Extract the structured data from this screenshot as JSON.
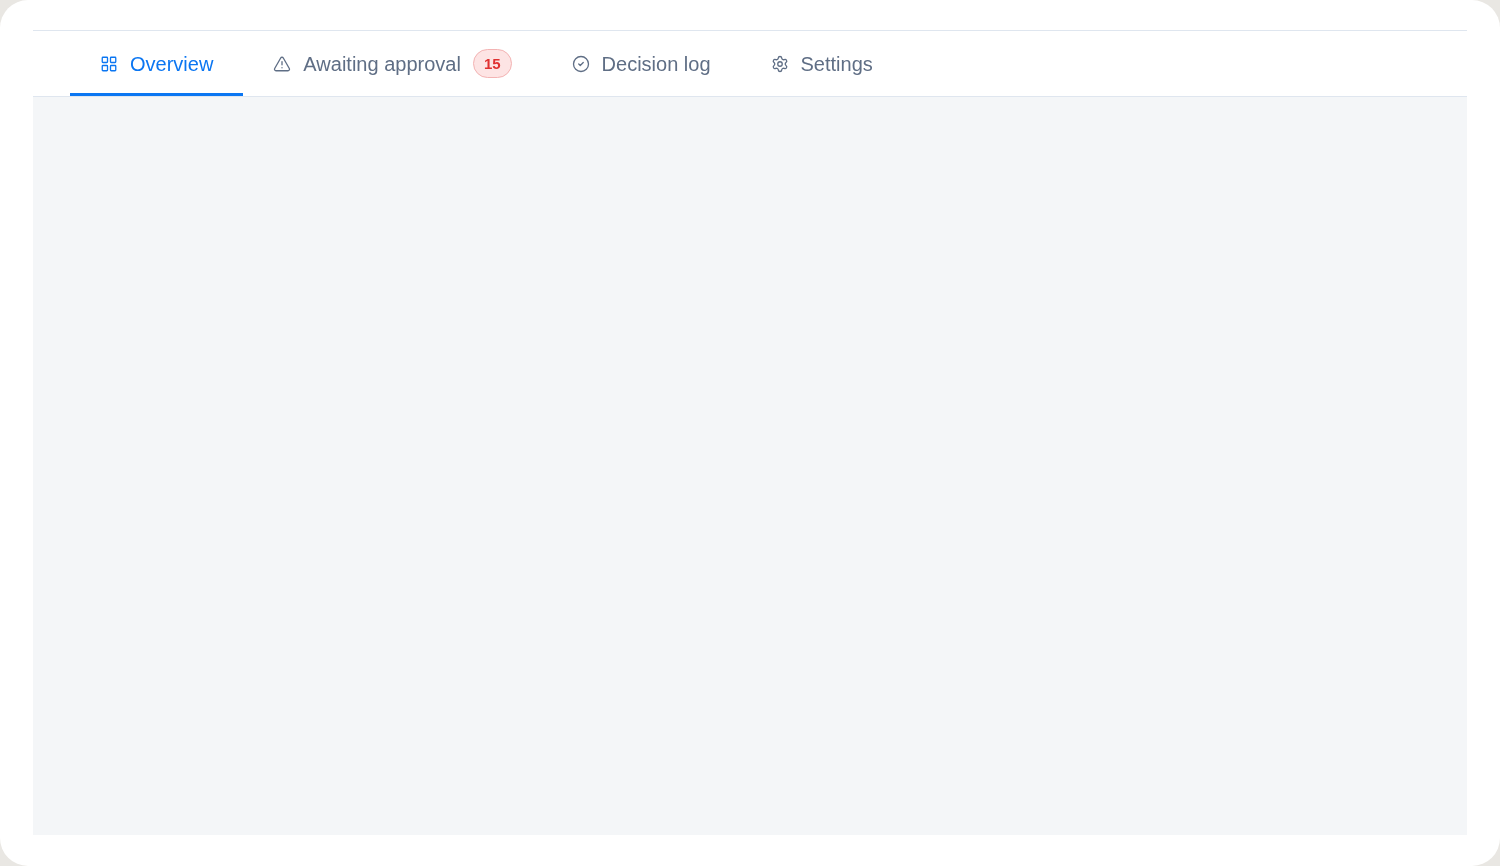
{
  "tabs": [
    {
      "label": "Overview",
      "selected": true
    },
    {
      "label": "Awaiting approval",
      "selected": false,
      "badge": "15"
    },
    {
      "label": "Decision log",
      "selected": false
    },
    {
      "label": "Settings",
      "selected": false
    }
  ]
}
